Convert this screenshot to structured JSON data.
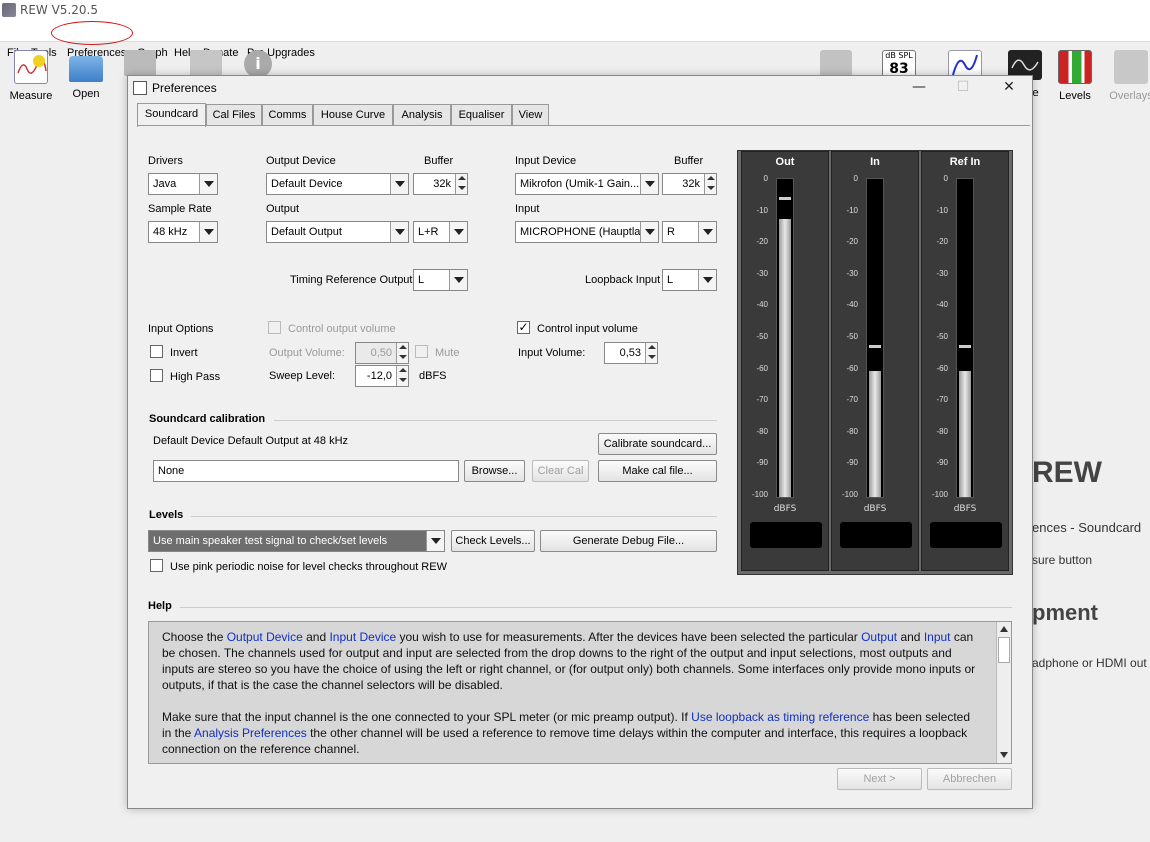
{
  "app": {
    "title": "REW V5.20.5"
  },
  "menu": [
    "File",
    "Tools",
    "Preferences",
    "Graph",
    "Help",
    "Donate",
    "Pro Upgrades"
  ],
  "toolbar": {
    "left": [
      "Measure",
      "Open"
    ],
    "right": [
      "Levels",
      "Overlays"
    ],
    "spl_label": "dB SPL",
    "spl_value": "83",
    "partial_label": "be"
  },
  "background": {
    "heading1": "REW",
    "line1": "ences - Soundcard",
    "line2": "sure button",
    "heading2": "pment",
    "line3": "adphone or HDMI out"
  },
  "dialog": {
    "title": "Preferences",
    "tabs": [
      "Soundcard",
      "Cal Files",
      "Comms",
      "House Curve",
      "Analysis",
      "Equaliser",
      "View"
    ],
    "drivers_label": "Drivers",
    "drivers_value": "Java",
    "sample_rate_label": "Sample Rate",
    "sample_rate_value": "48 kHz",
    "output_device_label": "Output Device",
    "output_device_value": "Default Device",
    "buffer_label": "Buffer",
    "out_buffer_value": "32k",
    "output_label": "Output",
    "output_value": "Default Output",
    "output_channel_value": "L+R",
    "input_device_label": "Input Device",
    "input_device_value": "Mikrofon (Umik-1  Gain...",
    "in_buffer_value": "32k",
    "input_label": "Input",
    "input_value": "MICROPHONE (Hauptla...",
    "input_channel_value": "R",
    "timing_ref_label": "Timing Reference Output",
    "timing_ref_value": "L",
    "loopback_label": "Loopback Input",
    "loopback_value": "L",
    "input_options_label": "Input Options",
    "invert_label": "Invert",
    "high_pass_label": "High Pass",
    "control_output_label": "Control output volume",
    "output_volume_label": "Output Volume:",
    "output_volume_value": "0,50",
    "mute_label": "Mute",
    "sweep_level_label": "Sweep Level:",
    "sweep_level_value": "-12,0",
    "dbfs_unit": "dBFS",
    "control_input_label": "Control input volume",
    "input_volume_label": "Input Volume:",
    "input_volume_value": "0,53",
    "calibration_section": "Soundcard calibration",
    "calibration_desc": "Default Device Default Output at 48 kHz",
    "calibrate_button": "Calibrate soundcard...",
    "cal_file_value": "None",
    "browse_button": "Browse...",
    "clear_cal_button": "Clear Cal",
    "make_cal_button": "Make cal file...",
    "levels_section": "Levels",
    "levels_combo_value": "Use main speaker test signal to check/set levels",
    "check_levels_button": "Check Levels...",
    "debug_button": "Generate Debug File...",
    "pink_noise_label": "Use pink periodic noise for level checks throughout REW",
    "help_section": "Help",
    "next_button": "Next >",
    "cancel_button": "Abbrechen"
  },
  "meters": {
    "titles": [
      "Out",
      "In",
      "Ref In"
    ],
    "ticks": [
      "0",
      "-10",
      "-20",
      "-30",
      "-40",
      "-50",
      "-60",
      "-70",
      "-80",
      "-90",
      "-100"
    ],
    "unit": "dBFS",
    "levels_dbfs": [
      -12,
      -60,
      -60
    ],
    "peaks_dbfs": [
      -5,
      -52,
      -52
    ]
  },
  "help": {
    "p1": [
      {
        "t": "Choose the ",
        "h": false
      },
      {
        "t": "Output Device",
        "h": true
      },
      {
        "t": " and ",
        "h": false
      },
      {
        "t": "Input Device",
        "h": true
      },
      {
        "t": " you wish to use for measurements. After the devices have been selected the particular ",
        "h": false
      },
      {
        "t": "Output",
        "h": true
      },
      {
        "t": " and ",
        "h": false
      },
      {
        "t": "Input",
        "h": true
      },
      {
        "t": " can be chosen. The channels used for output and input are selected from the drop downs to the right of the output and input selections, most outputs and inputs are stereo so you have the choice of using the left or right channel, or (for output only) both channels. Some interfaces only provide mono inputs or outputs, if that is the case the channel selectors will be disabled.",
        "h": false
      }
    ],
    "p2": [
      {
        "t": "Make sure that the input channel is the one connected to your SPL meter (or mic preamp output). If ",
        "h": false
      },
      {
        "t": "Use loopback as timing reference",
        "h": true
      },
      {
        "t": " has been selected in the ",
        "h": false
      },
      {
        "t": "Analysis Preferences",
        "h": true
      },
      {
        "t": " the other channel will be used a reference to remove time delays within the computer and interface, this requires a loopback connection on the reference channel.",
        "h": false
      }
    ]
  }
}
